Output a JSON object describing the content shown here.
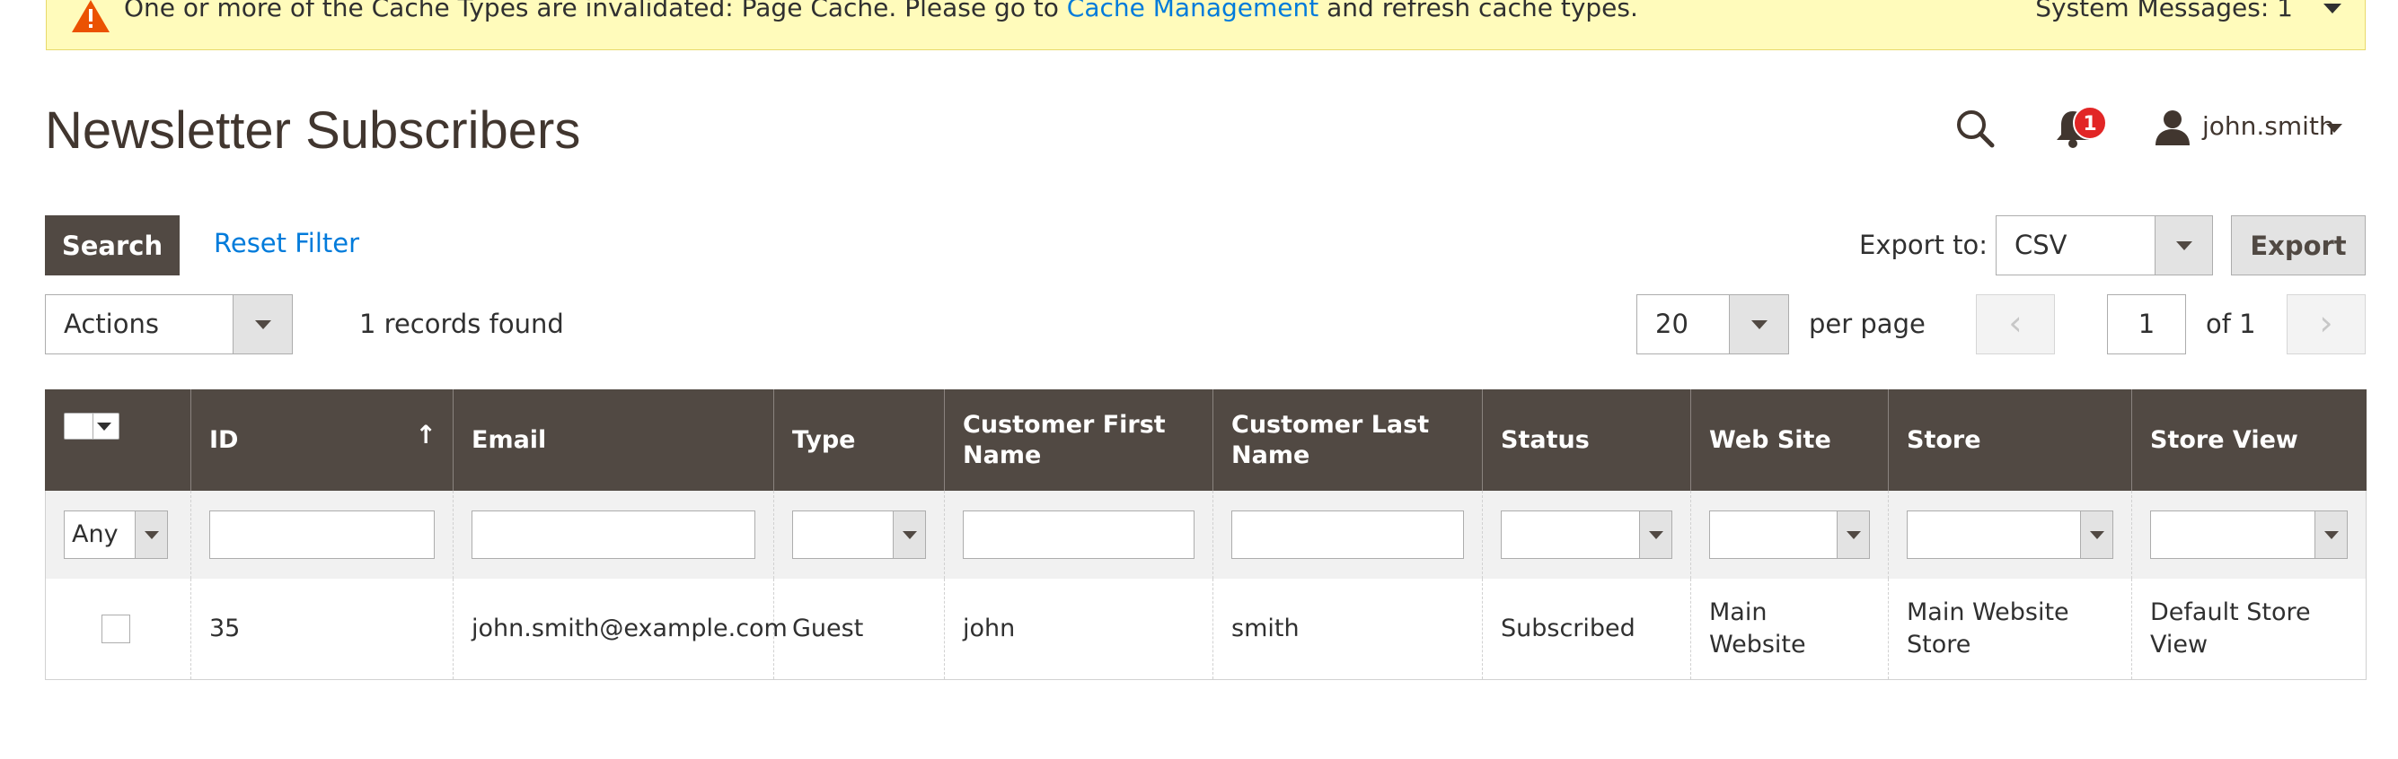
{
  "system_message": {
    "text_before": "One or more of the Cache Types are invalidated: Page Cache. Please go to ",
    "link": "Cache Management",
    "text_after": " and refresh cache types.",
    "right": "System Messages: 1"
  },
  "header": {
    "title": "Newsletter Subscribers",
    "notifications_count": "1",
    "user_name": "john.smith"
  },
  "toolbar": {
    "search_label": "Search",
    "reset_label": "Reset Filter",
    "export_label": "Export to:",
    "export_format": "CSV",
    "export_button": "Export",
    "actions_label": "Actions",
    "records_found": "1 records found",
    "per_page_value": "20",
    "per_page_label": "per page",
    "current_page": "1",
    "of_pages": "of 1",
    "prev_icon": "‹",
    "next_icon": "›"
  },
  "grid": {
    "columns": [
      {
        "label": ""
      },
      {
        "label": "ID",
        "sort_icon": "↑"
      },
      {
        "label": "Email"
      },
      {
        "label": "Type"
      },
      {
        "label": "Customer First Name"
      },
      {
        "label": "Customer Last Name"
      },
      {
        "label": "Status"
      },
      {
        "label": "Web Site"
      },
      {
        "label": "Store"
      },
      {
        "label": "Store View"
      }
    ],
    "filter_any": "Any",
    "rows": [
      {
        "id": "35",
        "email": "john.smith@example.com",
        "type": "Guest",
        "first_name": "john",
        "last_name": "smith",
        "status": "Subscribed",
        "website": "Main Website",
        "store": "Main Website Store",
        "store_view": "Default Store View"
      }
    ]
  }
}
